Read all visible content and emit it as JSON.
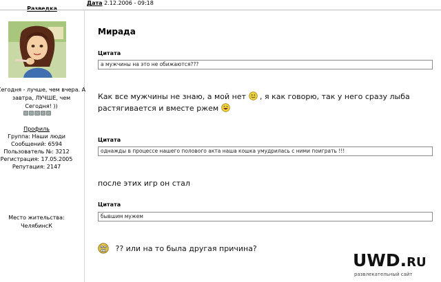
{
  "header": {
    "nav_link": "Разведка",
    "date_label": "Дата",
    "date_value": "2.12.2006 - 09:18"
  },
  "user": {
    "status_lines": [
      "Сегодня - лучше, чем вчера. А",
      "завтра, ЛУЧШЕ, чем",
      "Сегодня! ))"
    ],
    "profile_link": "Профиль",
    "group": "Группа: Наши люди",
    "posts": "Сообщений: 6594",
    "user_no": "Пользователь №: 3212",
    "registered": "Регистрация: 17.05.2005",
    "reputation": "Репутация: 2147",
    "location_label": "Место жительства:",
    "location_value": "ЧелябинсК"
  },
  "post": {
    "title": "Мирада",
    "quote_label": "Цитата",
    "quote1": "а мужчины на это не обижаются???",
    "para1_a": "Как все мужчины не знаю, а мой нет",
    "para1_b": ", я как говорю, так у него сразу лыба",
    "para1_c": "растягивается и вместе ржем",
    "quote2": "однажды в процессе нашего полового акта наша кошка умудрилась с ними поиграть !!!",
    "para2": "после этих игр он стал",
    "quote3": "бывшим мужем",
    "para3": "?? или на то была другая причина?"
  },
  "watermark": {
    "logo_main": "UWD.",
    "logo_ru": "RU",
    "tagline": "развлекательный сайт"
  },
  "colors": {
    "border": "#8a8a8a",
    "smiley": "#f0d23c",
    "divider": "#d6d6d6"
  },
  "icons": [
    "smile-icon",
    "laugh-icon",
    "scared-icon"
  ]
}
